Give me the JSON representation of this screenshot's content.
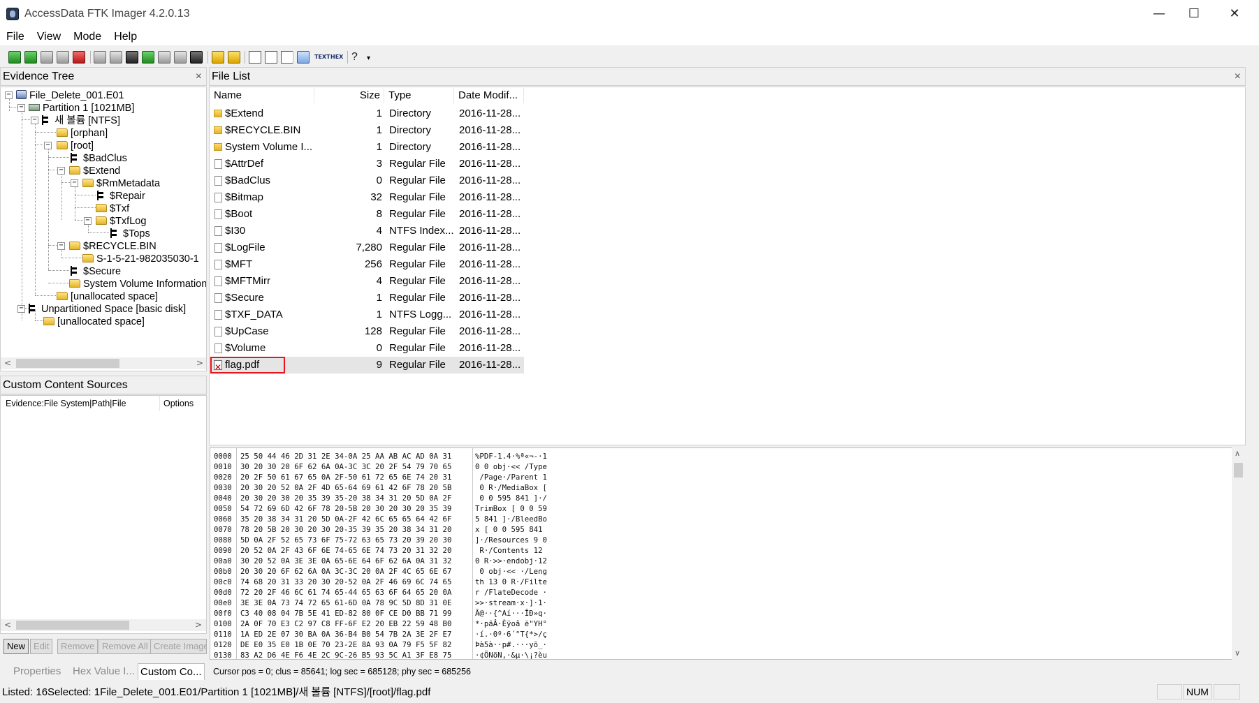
{
  "window": {
    "title": "AccessData FTK Imager 4.2.0.13",
    "controls": {
      "minimize": "—",
      "maximize": "☐",
      "close": "✕"
    }
  },
  "menu": [
    "File",
    "View",
    "Mode",
    "Help"
  ],
  "evidence_tree": {
    "header": "Evidence Tree",
    "close": "×",
    "nodes": [
      "File_Delete_001.E01",
      "Partition 1 [1021MB]",
      "새 볼륨 [NTFS]",
      "[orphan]",
      "[root]",
      "$BadClus",
      "$Extend",
      "$RmMetadata",
      "$Repair",
      "$Txf",
      "$TxfLog",
      "$Tops",
      "$RECYCLE.BIN",
      "S-1-5-21-982035030-1",
      "$Secure",
      "System Volume Information",
      "[unallocated space]",
      "Unpartitioned Space [basic disk]",
      "[unallocated space]"
    ]
  },
  "custom_content": {
    "header": "Custom Content Sources",
    "col_evidence": "Evidence:File System|Path|File",
    "col_options": "Options",
    "buttons": [
      "New",
      "Edit",
      "Remove",
      "Remove All",
      "Create Image"
    ],
    "tabs": [
      "Properties",
      "Hex Value I...",
      "Custom Co..."
    ]
  },
  "file_list": {
    "header": "File List",
    "close": "×",
    "columns": [
      "Name",
      "Size",
      "Type",
      "Date Modif..."
    ],
    "rows": [
      {
        "name": "$Extend",
        "size": "1",
        "type": "Directory",
        "date": "2016-11-28...",
        "kind": "dir"
      },
      {
        "name": "$RECYCLE.BIN",
        "size": "1",
        "type": "Directory",
        "date": "2016-11-28...",
        "kind": "dir"
      },
      {
        "name": "System Volume I...",
        "size": "1",
        "type": "Directory",
        "date": "2016-11-28...",
        "kind": "dir"
      },
      {
        "name": "$AttrDef",
        "size": "3",
        "type": "Regular File",
        "date": "2016-11-28...",
        "kind": "file"
      },
      {
        "name": "$BadClus",
        "size": "0",
        "type": "Regular File",
        "date": "2016-11-28...",
        "kind": "file"
      },
      {
        "name": "$Bitmap",
        "size": "32",
        "type": "Regular File",
        "date": "2016-11-28...",
        "kind": "file"
      },
      {
        "name": "$Boot",
        "size": "8",
        "type": "Regular File",
        "date": "2016-11-28...",
        "kind": "file"
      },
      {
        "name": "$I30",
        "size": "4",
        "type": "NTFS Index...",
        "date": "2016-11-28...",
        "kind": "file"
      },
      {
        "name": "$LogFile",
        "size": "7,280",
        "type": "Regular File",
        "date": "2016-11-28...",
        "kind": "file"
      },
      {
        "name": "$MFT",
        "size": "256",
        "type": "Regular File",
        "date": "2016-11-28...",
        "kind": "file"
      },
      {
        "name": "$MFTMirr",
        "size": "4",
        "type": "Regular File",
        "date": "2016-11-28...",
        "kind": "file"
      },
      {
        "name": "$Secure",
        "size": "1",
        "type": "Regular File",
        "date": "2016-11-28...",
        "kind": "file"
      },
      {
        "name": "$TXF_DATA",
        "size": "1",
        "type": "NTFS Logg...",
        "date": "2016-11-28...",
        "kind": "file"
      },
      {
        "name": "$UpCase",
        "size": "128",
        "type": "Regular File",
        "date": "2016-11-28...",
        "kind": "file"
      },
      {
        "name": "$Volume",
        "size": "0",
        "type": "Regular File",
        "date": "2016-11-28...",
        "kind": "file"
      },
      {
        "name": "flag.pdf",
        "size": "9",
        "type": "Regular File",
        "date": "2016-11-28...",
        "kind": "deleted"
      }
    ]
  },
  "hex_view": {
    "rows": [
      {
        "off": "0000",
        "bytes": "25 50 44 46 2D 31 2E 34-0A 25 AA AB AC AD 0A 31",
        "ascii": "%PDF-1.4·%ª«¬-·1"
      },
      {
        "off": "0010",
        "bytes": "30 20 30 20 6F 62 6A 0A-3C 3C 20 2F 54 79 70 65",
        "ascii": "0 0 obj·<< /Type"
      },
      {
        "off": "0020",
        "bytes": "20 2F 50 61 67 65 0A 2F-50 61 72 65 6E 74 20 31",
        "ascii": " /Page·/Parent 1"
      },
      {
        "off": "0030",
        "bytes": "20 30 20 52 0A 2F 4D 65-64 69 61 42 6F 78 20 5B",
        "ascii": " 0 R·/MediaBox ["
      },
      {
        "off": "0040",
        "bytes": "20 30 20 30 20 35 39 35-20 38 34 31 20 5D 0A 2F",
        "ascii": " 0 0 595 841 ]·/"
      },
      {
        "off": "0050",
        "bytes": "54 72 69 6D 42 6F 78 20-5B 20 30 20 30 20 35 39",
        "ascii": "TrimBox [ 0 0 59"
      },
      {
        "off": "0060",
        "bytes": "35 20 38 34 31 20 5D 0A-2F 42 6C 65 65 64 42 6F",
        "ascii": "5 841 ]·/BleedBo"
      },
      {
        "off": "0070",
        "bytes": "78 20 5B 20 30 20 30 20-35 39 35 20 38 34 31 20",
        "ascii": "x [ 0 0 595 841 "
      },
      {
        "off": "0080",
        "bytes": "5D 0A 2F 52 65 73 6F 75-72 63 65 73 20 39 20 30",
        "ascii": "]·/Resources 9 0"
      },
      {
        "off": "0090",
        "bytes": "20 52 0A 2F 43 6F 6E 74-65 6E 74 73 20 31 32 20",
        "ascii": " R·/Contents 12 "
      },
      {
        "off": "00a0",
        "bytes": "30 20 52 0A 3E 3E 0A 65-6E 64 6F 62 6A 0A 31 32",
        "ascii": "0 R·>>·endobj·12"
      },
      {
        "off": "00b0",
        "bytes": "20 30 20 6F 62 6A 0A 3C-3C 20 0A 2F 4C 65 6E 67",
        "ascii": " 0 obj·<< ·/Leng"
      },
      {
        "off": "00c0",
        "bytes": "74 68 20 31 33 20 30 20-52 0A 2F 46 69 6C 74 65",
        "ascii": "th 13 0 R·/Filte"
      },
      {
        "off": "00d0",
        "bytes": "72 20 2F 46 6C 61 74 65-44 65 63 6F 64 65 20 0A",
        "ascii": "r /FlateDecode ·"
      },
      {
        "off": "00e0",
        "bytes": "3E 3E 0A 73 74 72 65 61-6D 0A 78 9C 5D 8D 31 0E",
        "ascii": ">>·stream·x·]·1·"
      },
      {
        "off": "00f0",
        "bytes": "C3 40 08 04 7B 5E 41 ED-82 80 0F CE D0 BB 71 99",
        "ascii": "Ã@··{^Aí···ÎÐ»q·"
      },
      {
        "off": "0100",
        "bytes": "2A 0F 70 E3 C2 97 C8 FF-6F E2 20 EB 22 59 48 B0",
        "ascii": "*·pãÂ·Èÿoâ ë\"YH°"
      },
      {
        "off": "0110",
        "bytes": "1A ED 2E 07 30 BA 0A 36-B4 B0 54 7B 2A 3E 2F E7",
        "ascii": "·í.·0º·6´°T{*>/ç"
      },
      {
        "off": "0120",
        "bytes": "DE E0 35 E0 1B 0E 70 23-2E 8A 93 0A 79 F5 5F 82",
        "ascii": "Þà5à··p#.···yõ_·"
      },
      {
        "off": "0130",
        "bytes": "83 A2 D6 4E F6 4E 2C 9C-26 B5 93 5C A1 3F E8 75",
        "ascii": "·¢ÖNöN,·&µ·\\¡?èu"
      }
    ],
    "cursor_info": "Cursor pos = 0; clus = 85641; log sec = 685128; phy sec = 685256"
  },
  "status_bar": {
    "text": "Listed: 16Selected: 1File_Delete_001.E01/Partition 1 [1021MB]/새 볼륨 [NTFS]/[root]/flag.pdf",
    "num": "NUM"
  },
  "colors": {
    "highlight_box": "#e8141a",
    "selected_row": "#e5e5e5"
  }
}
